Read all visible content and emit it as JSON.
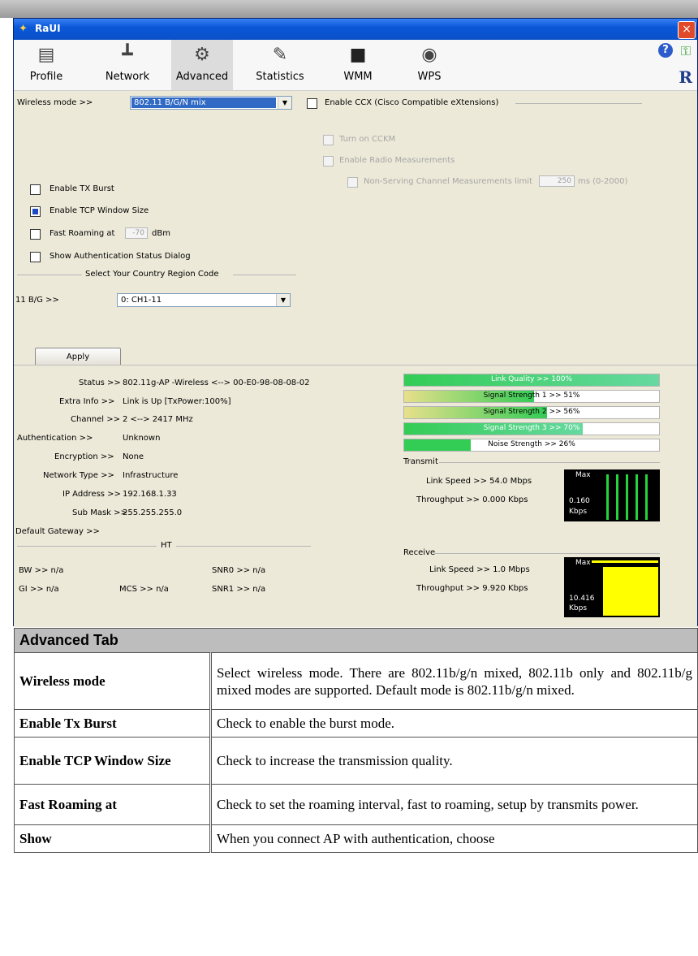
{
  "window": {
    "title": "RaUI",
    "close_glyph": "×"
  },
  "toolbar": {
    "tabs": [
      {
        "label": "Profile",
        "icon": "profile-icon"
      },
      {
        "label": "Network",
        "icon": "network-icon"
      },
      {
        "label": "Advanced",
        "icon": "gears-icon"
      },
      {
        "label": "Statistics",
        "icon": "statistics-icon"
      },
      {
        "label": "WMM",
        "icon": "wmm-icon"
      },
      {
        "label": "WPS",
        "icon": "wps-icon"
      }
    ],
    "active_tab": "Advanced",
    "help_glyph": "?",
    "r_glyph": "R"
  },
  "advanced": {
    "wireless_mode_label": "Wireless mode >>",
    "wireless_mode_value": "802.11 B/G/N mix",
    "ccx_label": "Enable CCX (Cisco Compatible eXtensions)",
    "ccx_checked": false,
    "cckm_label": "Turn on CCKM",
    "radio_meas_label": "Enable Radio Measurements",
    "nonserving_label": "Non-Serving Channel Measurements limit",
    "nonserving_value": "250",
    "nonserving_unit": "ms (0-2000)",
    "tx_burst_label": "Enable TX Burst",
    "tx_burst_checked": false,
    "tcp_window_label": "Enable TCP Window Size",
    "tcp_window_checked": true,
    "fast_roaming_label": "Fast Roaming at",
    "fast_roaming_value": "-70",
    "fast_roaming_unit": "dBm",
    "show_auth_label": "Show Authentication Status Dialog",
    "country_header": "Select Your Country Region Code",
    "country_band_label": "11 B/G >>",
    "country_value": "0: CH1-11",
    "apply_label": "Apply"
  },
  "status": {
    "status_label": "Status >>",
    "status_value": "802.11g-AP -Wireless <--> 00-E0-98-08-08-02",
    "extra_label": "Extra Info >>",
    "extra_value": "Link is Up [TxPower:100%]",
    "channel_label": "Channel >>",
    "channel_value": "2 <--> 2417 MHz",
    "auth_label": "Authentication >>",
    "auth_value": "Unknown",
    "enc_label": "Encryption >>",
    "enc_value": "None",
    "nettype_label": "Network Type >>",
    "nettype_value": "Infrastructure",
    "ip_label": "IP Address >>",
    "ip_value": "192.168.1.33",
    "mask_label": "Sub Mask >>",
    "mask_value": "255.255.255.0",
    "gateway_label": "Default Gateway >>",
    "gateway_value": "",
    "ht_header": "HT",
    "bw": "BW >> n/a",
    "gi": "GI >> n/a",
    "mcs": "MCS >> n/a",
    "snr0": "SNR0 >> n/a",
    "snr1": "SNR1 >> n/a"
  },
  "signal": {
    "link_quality": {
      "text": "Link Quality >> 100%",
      "percent": 100
    },
    "strength1": {
      "text": "Signal Strength 1 >> 51%",
      "percent": 51
    },
    "strength2": {
      "text": "Signal Strength 2 >> 56%",
      "percent": 56
    },
    "strength3": {
      "text": "Signal Strength 3 >> 70%",
      "percent": 70
    },
    "noise": {
      "text": "Noise Strength >> 26%",
      "percent": 26
    }
  },
  "transmit": {
    "header": "Transmit",
    "link_speed": "Link Speed >> 54.0 Mbps",
    "throughput": "Throughput >> 0.000 Kbps",
    "graph_max": "Max",
    "graph_value": "0.160",
    "graph_unit": "Kbps"
  },
  "receive": {
    "header": "Receive",
    "link_speed": "Link Speed >> 1.0 Mbps",
    "throughput": "Throughput >> 9.920 Kbps",
    "graph_max": "Max",
    "graph_value": "10.416",
    "graph_unit": "Kbps"
  },
  "doc": {
    "header": "Advanced Tab",
    "rows": [
      {
        "term": "Wireless mode",
        "desc": "Select wireless mode. There are 802.11b/g/n mixed, 802.11b only and 802.11b/g mixed modes are supported. Default mode is 802.11b/g/n mixed."
      },
      {
        "term": "Enable Tx Burst",
        "desc": "Check to enable the burst mode."
      },
      {
        "term": "Enable TCP Window Size",
        "desc": "Check to increase the transmission quality."
      },
      {
        "term": "Fast Roaming at",
        "desc": "Check to set the roaming interval, fast to roaming, setup by transmits power."
      },
      {
        "term": "Show",
        "desc": "When you connect AP with authentication, choose"
      }
    ]
  },
  "colors": {
    "accent_green": "#33cc55",
    "bar_empty": "#ffffff",
    "throughput_yellow": "#ffff00",
    "title_blue": "#0a58d8"
  }
}
